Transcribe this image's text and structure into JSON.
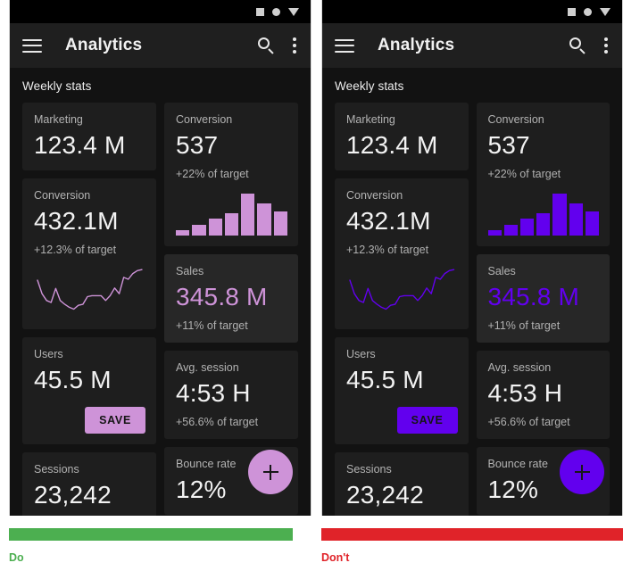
{
  "panels": [
    {
      "id": "do",
      "verdict_label": "Do",
      "verdict_color": "#4CAF50",
      "accent": "#CE93D8",
      "accent_name": "light-purple-200",
      "on_accent_text": "#151515"
    },
    {
      "id": "dont",
      "verdict_label": "Don't",
      "verdict_color": "#E02329",
      "accent": "#6200EE",
      "accent_name": "deep-purple-600",
      "on_accent_text": "#151515"
    }
  ],
  "statusbar": {
    "icons": [
      "square-icon",
      "circle-icon",
      "triangle-down-icon"
    ]
  },
  "appbar": {
    "menu_icon": "hamburger-menu-icon",
    "title": "Analytics",
    "search_icon": "search-icon",
    "overflow_icon": "more-vert-icon"
  },
  "content": {
    "section_title": "Weekly stats",
    "fab": {
      "icon": "plus-icon",
      "label": "Add"
    },
    "save_button_label": "SAVE",
    "left_column": [
      {
        "name": "marketing-card",
        "label": "Marketing",
        "value": "123.4 M",
        "sub": "",
        "selected": false
      },
      {
        "name": "conversion-card",
        "label": "Conversion",
        "value": "432.1M",
        "sub": "+12.3% of target",
        "selected": false
      },
      {
        "name": "users-card",
        "label": "Users",
        "value": "45.5 M",
        "sub": "",
        "selected": false
      },
      {
        "name": "sessions-card",
        "label": "Sessions",
        "value": "23,242",
        "sub": "",
        "selected": false
      }
    ],
    "right_column": [
      {
        "name": "conversion-chart-card",
        "label": "Conversion",
        "value": "537",
        "sub": "+22% of target",
        "selected": false
      },
      {
        "name": "sales-card",
        "label": "Sales",
        "value": "345.8 M",
        "sub": "+11% of target",
        "selected": true
      },
      {
        "name": "avg-session-card",
        "label": "Avg. session",
        "value": "4:53 H",
        "sub": "+56.6% of target",
        "selected": false
      },
      {
        "name": "bounce-rate-card",
        "label": "Bounce rate",
        "value": "12%",
        "sub": "",
        "selected": false
      }
    ]
  },
  "chart_data": [
    {
      "type": "bar",
      "title": "Conversion",
      "categories": [
        "1",
        "2",
        "3",
        "4",
        "5",
        "6",
        "7"
      ],
      "values": [
        12,
        24,
        38,
        50,
        94,
        72,
        55
      ],
      "xlabel": "",
      "ylabel": "",
      "ylim": [
        0,
        100
      ],
      "grid": false,
      "legend": "none"
    },
    {
      "type": "line",
      "title": "Conversion",
      "x": [
        0,
        1,
        2,
        3,
        4,
        5,
        6,
        7,
        8,
        9,
        10,
        11,
        12,
        13,
        14,
        15,
        16,
        17,
        18,
        19,
        20,
        21,
        22,
        23
      ],
      "values": [
        72,
        44,
        30,
        26,
        55,
        30,
        22,
        16,
        12,
        20,
        22,
        38,
        40,
        40,
        40,
        30,
        40,
        56,
        44,
        78,
        74,
        86,
        92,
        94
      ],
      "xlabel": "",
      "ylabel": "",
      "ylim": [
        0,
        100
      ],
      "grid": false,
      "legend": "none"
    }
  ]
}
